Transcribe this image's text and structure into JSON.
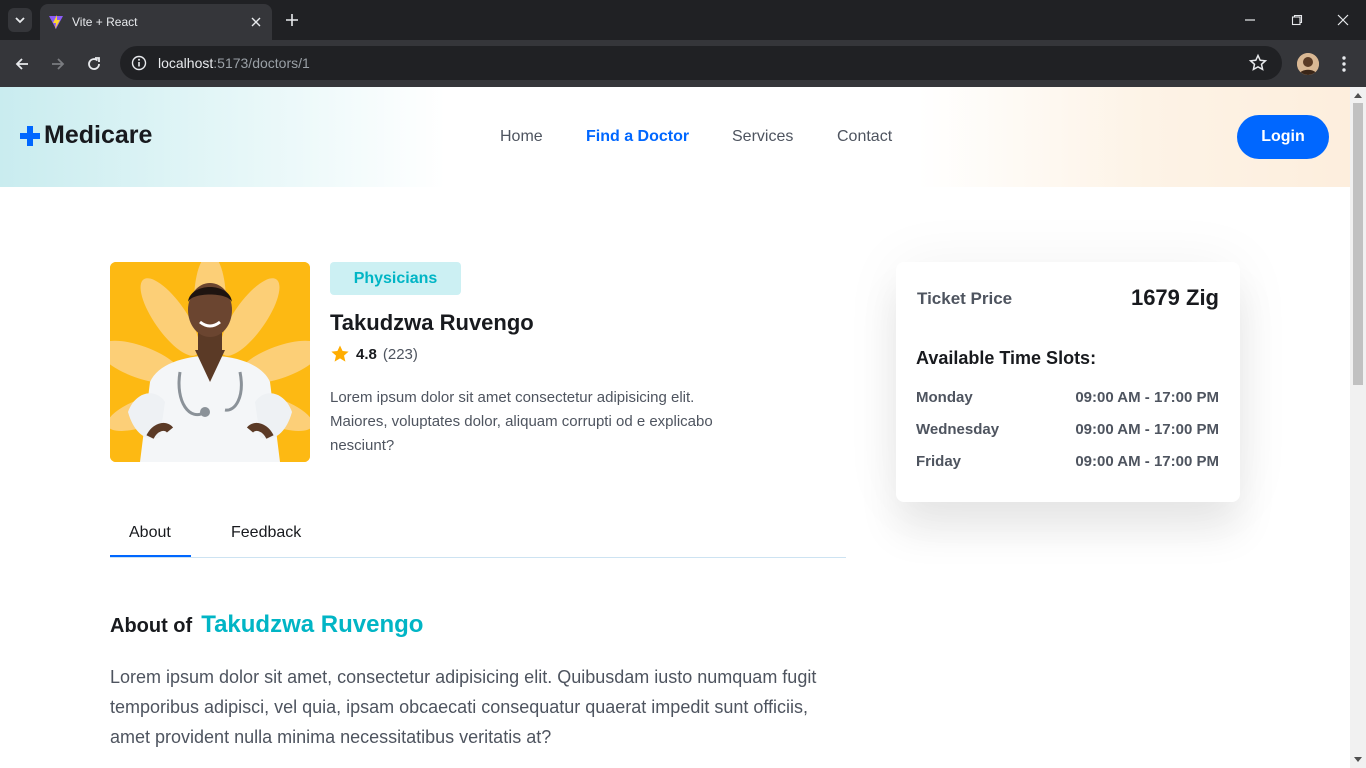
{
  "browser": {
    "tab_title": "Vite + React",
    "url_host": "localhost",
    "url_rest": ":5173/doctors/1",
    "icons": [
      "tab-list-icon",
      "vite-favicon",
      "close-icon",
      "plus-icon",
      "minimize-icon",
      "restore-icon",
      "close-window-icon",
      "back-icon",
      "forward-icon",
      "reload-icon",
      "info-icon",
      "star-icon",
      "profile-avatar",
      "kebab-menu-icon"
    ]
  },
  "header": {
    "logo": "Medicare",
    "nav": [
      "Home",
      "Find a Doctor",
      "Services",
      "Contact"
    ],
    "active_nav": "Find a Doctor",
    "login_label": "Login"
  },
  "doctor": {
    "specialty": "Physicians",
    "name": "Takudzwa Ruvengo",
    "rating": "4.8",
    "rating_count": "(223)",
    "short_bio": "Lorem ipsum dolor sit amet consectetur adipisicing elit. Maiores, voluptates dolor, aliquam corrupti od e explicabo nesciunt?"
  },
  "tabs": {
    "about": "About",
    "feedback": "Feedback"
  },
  "about": {
    "heading": "About of",
    "name": "Takudzwa Ruvengo",
    "text": "Lorem ipsum dolor sit amet, consectetur adipisicing elit. Quibusdam iusto numquam fugit temporibus adipisci, vel quia, ipsam obcaecati consequatur quaerat impedit sunt officiis, amet provident nulla minima necessitatibus veritatis at?"
  },
  "booking": {
    "price_label": "Ticket Price",
    "price": "1679 Zig",
    "slots_title": "Available Time Slots:",
    "slots": [
      {
        "day": "Monday",
        "time": "09:00 AM - 17:00 PM"
      },
      {
        "day": "Wednesday",
        "time": "09:00 AM - 17:00 PM"
      },
      {
        "day": "Friday",
        "time": "09:00 AM - 17:00 PM"
      }
    ]
  },
  "colors": {
    "primary": "#0067ff",
    "teal": "#01b5c5",
    "heading": "#181a1e",
    "text": "#4e545f",
    "photo_bg": "#fdb913"
  }
}
